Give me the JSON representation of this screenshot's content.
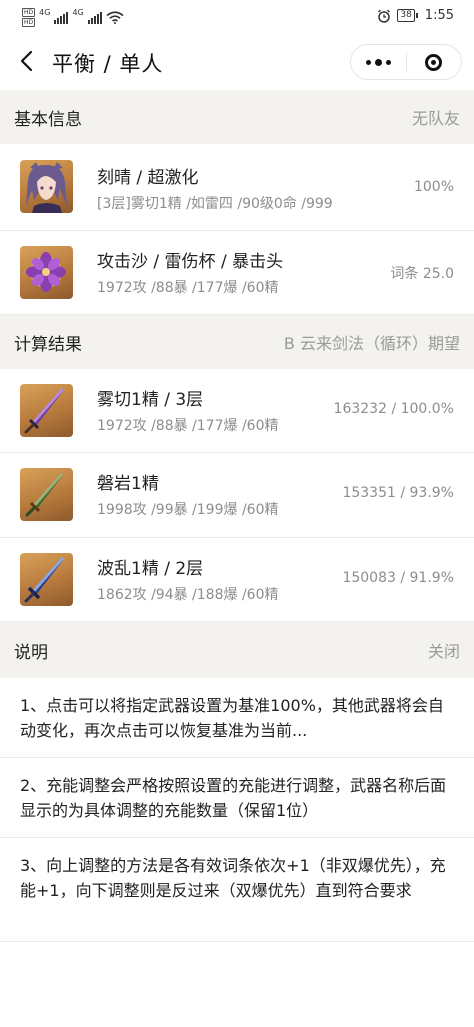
{
  "status_bar": {
    "hd1": "HD",
    "hd2": "HD",
    "net1": "4G",
    "net2": "4G",
    "battery": "38",
    "time": "1:55"
  },
  "nav": {
    "title": "平衡 / 单人"
  },
  "basic_info": {
    "header": "基本信息",
    "team": "无队友",
    "character": {
      "title": "刻晴 / 超激化",
      "sub": "[3层]雾切1精 /如雷四 /90级0命 /999",
      "value": "100%"
    },
    "artifact": {
      "title": "攻击沙 / 雷伤杯 / 暴击头",
      "sub": "1972攻 /88暴 /177爆 /60精",
      "value": "词条 25.0"
    }
  },
  "results": {
    "header": "计算结果",
    "mode": "B 云来剑法（循环）期望",
    "items": [
      {
        "title": "雾切1精 / 3层",
        "sub": "1972攻 /88暴 /177爆 /60精",
        "value": "163232 / 100.0%"
      },
      {
        "title": "磐岩1精",
        "sub": "1998攻 /99暴 /199爆 /60精",
        "value": "153351 / 93.9%"
      },
      {
        "title": "波乱1精 / 2层",
        "sub": "1862攻 /94暴 /188爆 /60精",
        "value": "150083 / 91.9%"
      }
    ]
  },
  "notes": {
    "header": "说明",
    "close": "关闭",
    "items": [
      "1、点击可以将指定武器设置为基准100%，其他武器将会自动变化，再次点击可以恢复基准为当前...",
      "2、充能调整会严格按照设置的充能进行调整，武器名称后面显示的为具体调整的充能数量（保留1位）",
      "3、向上调整的方法是各有效词条依次+1（非双爆优先），充能+1，向下调整则是反过来（双爆优先）直到符合要求"
    ]
  },
  "icons": {
    "back": "back-arrow-icon",
    "more": "more-dots-icon",
    "close": "target-close-icon"
  }
}
